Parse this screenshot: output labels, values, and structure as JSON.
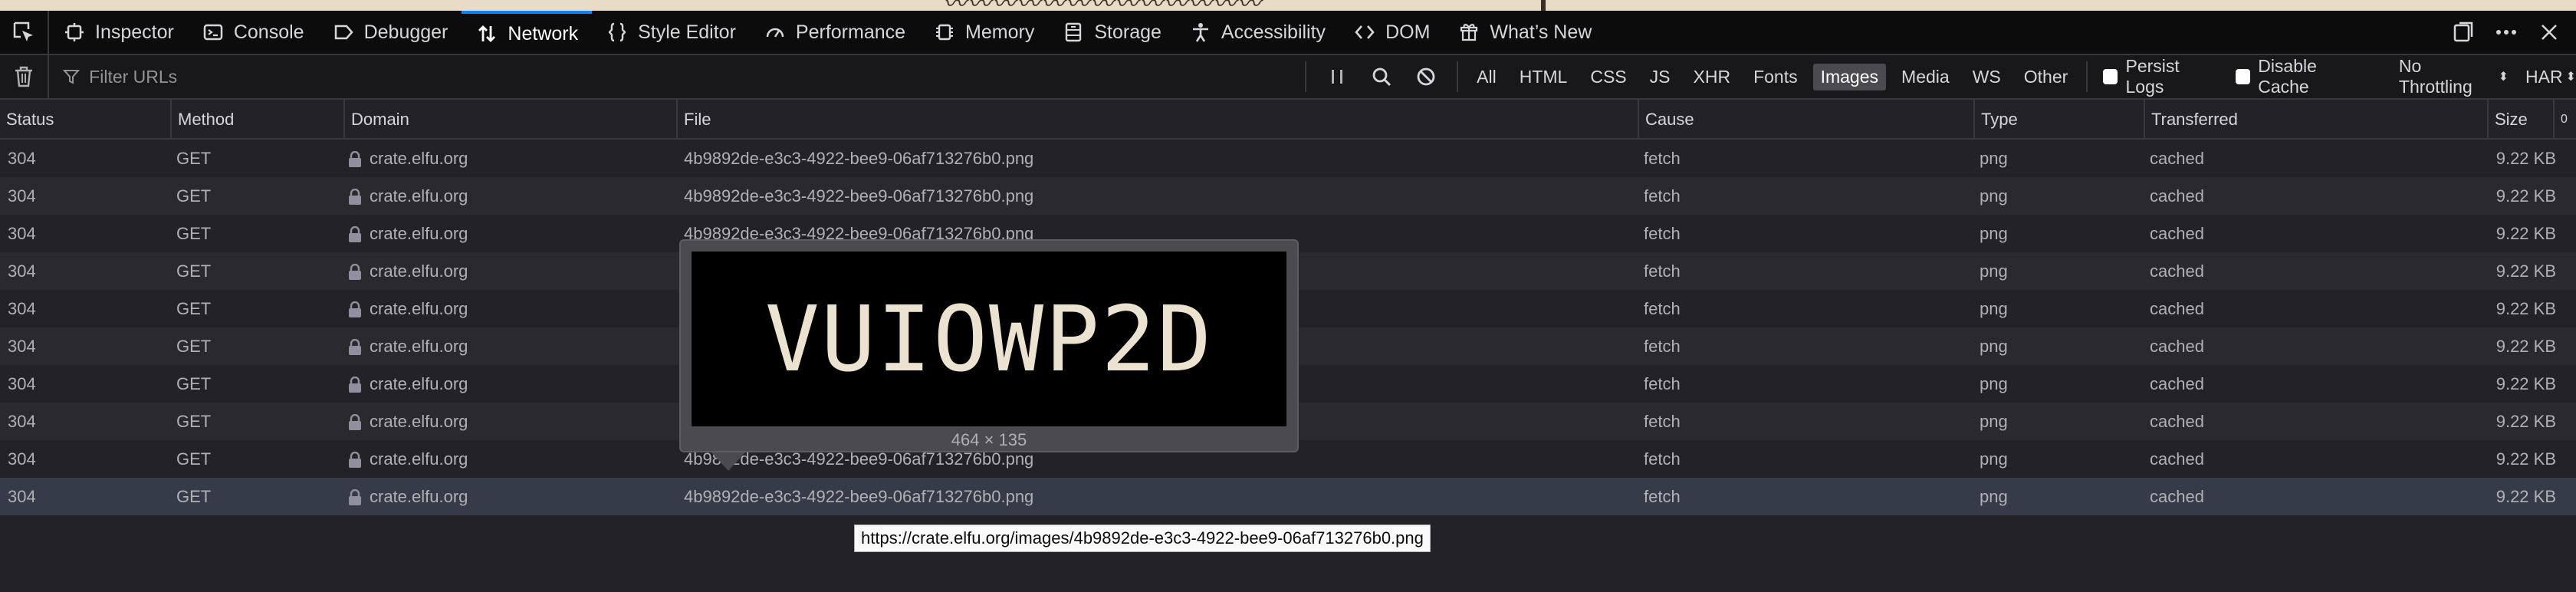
{
  "toolbox": {
    "tabs": [
      {
        "label": "Inspector",
        "icon": "inspector-icon"
      },
      {
        "label": "Console",
        "icon": "console-icon"
      },
      {
        "label": "Debugger",
        "icon": "debugger-icon"
      },
      {
        "label": "Network",
        "icon": "network-icon",
        "selected": true
      },
      {
        "label": "Style Editor",
        "icon": "style-editor-icon"
      },
      {
        "label": "Performance",
        "icon": "performance-icon"
      },
      {
        "label": "Memory",
        "icon": "memory-icon"
      },
      {
        "label": "Storage",
        "icon": "storage-icon"
      },
      {
        "label": "Accessibility",
        "icon": "accessibility-icon"
      },
      {
        "label": "DOM",
        "icon": "dom-icon"
      },
      {
        "label": "What’s New",
        "icon": "whats-new-icon"
      }
    ]
  },
  "toolbar": {
    "filter_placeholder": "Filter URLs",
    "type_filters": [
      "All",
      "HTML",
      "CSS",
      "JS",
      "XHR",
      "Fonts",
      "Images",
      "Media",
      "WS",
      "Other"
    ],
    "active_filter": "Images",
    "persist_logs_label": "Persist Logs",
    "disable_cache_label": "Disable Cache",
    "throttling_label": "No Throttling",
    "har_label": "HAR"
  },
  "table": {
    "columns": [
      "Status",
      "Method",
      "Domain",
      "File",
      "Cause",
      "Type",
      "Transferred",
      "Size",
      "0"
    ],
    "rows": [
      {
        "status": "304",
        "method": "GET",
        "domain": "crate.elfu.org",
        "file": "4b9892de-e3c3-4922-bee9-06af713276b0.png",
        "cause": "fetch",
        "type": "png",
        "transferred": "cached",
        "size": "9.22 KB"
      },
      {
        "status": "304",
        "method": "GET",
        "domain": "crate.elfu.org",
        "file": "4b9892de-e3c3-4922-bee9-06af713276b0.png",
        "cause": "fetch",
        "type": "png",
        "transferred": "cached",
        "size": "9.22 KB"
      },
      {
        "status": "304",
        "method": "GET",
        "domain": "crate.elfu.org",
        "file": "4b9892de-e3c3-4922-bee9-06af713276b0.png",
        "cause": "fetch",
        "type": "png",
        "transferred": "cached",
        "size": "9.22 KB"
      },
      {
        "status": "304",
        "method": "GET",
        "domain": "crate.elfu.org",
        "file": "",
        "cause": "fetch",
        "type": "png",
        "transferred": "cached",
        "size": "9.22 KB"
      },
      {
        "status": "304",
        "method": "GET",
        "domain": "crate.elfu.org",
        "file": "",
        "cause": "fetch",
        "type": "png",
        "transferred": "cached",
        "size": "9.22 KB"
      },
      {
        "status": "304",
        "method": "GET",
        "domain": "crate.elfu.org",
        "file": "",
        "cause": "fetch",
        "type": "png",
        "transferred": "cached",
        "size": "9.22 KB"
      },
      {
        "status": "304",
        "method": "GET",
        "domain": "crate.elfu.org",
        "file": "",
        "cause": "fetch",
        "type": "png",
        "transferred": "cached",
        "size": "9.22 KB"
      },
      {
        "status": "304",
        "method": "GET",
        "domain": "crate.elfu.org",
        "file": "",
        "cause": "fetch",
        "type": "png",
        "transferred": "cached",
        "size": "9.22 KB"
      },
      {
        "status": "304",
        "method": "GET",
        "domain": "crate.elfu.org",
        "file": "4b9892de-e3c3-4922-bee9-06af713276b0.png",
        "cause": "fetch",
        "type": "png",
        "transferred": "cached",
        "size": "9.22 KB"
      },
      {
        "status": "304",
        "method": "GET",
        "domain": "crate.elfu.org",
        "file": "4b9892de-e3c3-4922-bee9-06af713276b0.png",
        "cause": "fetch",
        "type": "png",
        "transferred": "cached",
        "size": "9.22 KB",
        "selected": true
      }
    ]
  },
  "preview": {
    "image_text": "VUIOWP2D",
    "dimensions": "464 × 135"
  },
  "tooltip": {
    "url": "https://crate.elfu.org/images/4b9892de-e3c3-4922-bee9-06af713276b0.png"
  }
}
